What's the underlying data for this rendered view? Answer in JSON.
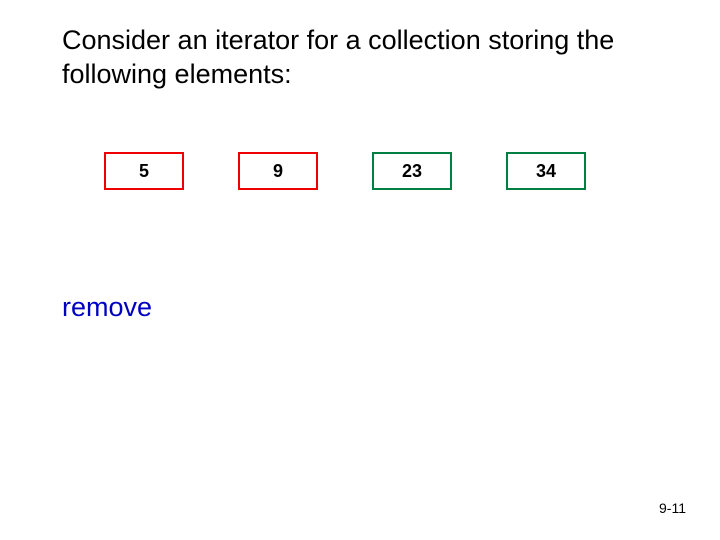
{
  "title": "Consider an iterator for a collection storing the following elements:",
  "elements": [
    {
      "value": "5",
      "state": "red"
    },
    {
      "value": "9",
      "state": "red"
    },
    {
      "value": "23",
      "state": "green"
    },
    {
      "value": "34",
      "state": "green"
    }
  ],
  "operation": "remove",
  "page_number": "9-11",
  "colors": {
    "red": "#ee0000",
    "green": "#008040",
    "op_text": "#0000c0"
  }
}
